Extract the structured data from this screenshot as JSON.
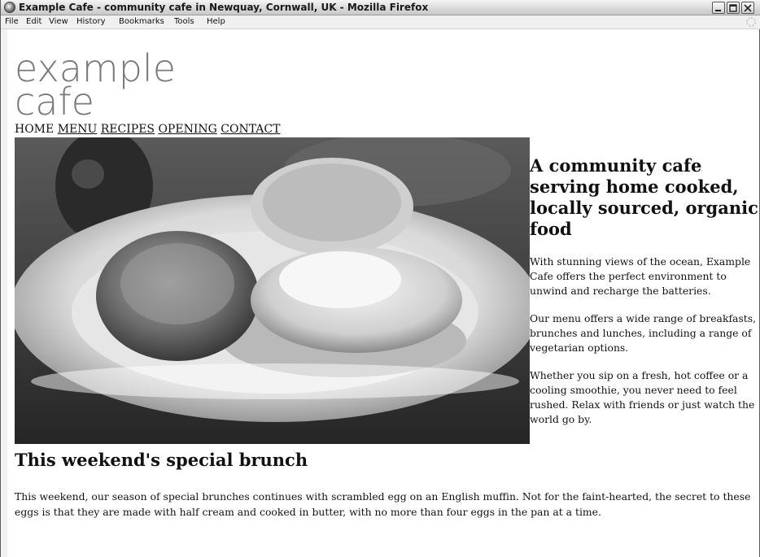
{
  "window": {
    "title": "Example Cafe - community cafe in Newquay, Cornwall, UK - Mozilla Firefox",
    "menu": [
      "File",
      "Edit",
      "View",
      "History",
      "Bookmarks",
      "Tools",
      "Help"
    ]
  },
  "site": {
    "logo_line1": "example",
    "logo_line2": "cafe",
    "nav": [
      "HOME",
      "MENU",
      "RECIPES",
      "OPENING",
      "CONTACT"
    ],
    "sidebar": {
      "heading": "A community cafe serving home cooked, locally sourced, organic food",
      "paragraphs": [
        "With stunning views of the ocean, Example Cafe offers the perfect environment to unwind and recharge the batteries.",
        "Our menu offers a wide range of breakfasts, brunches and lunches, including a range of vegetarian options.",
        "Whether you sip on a fresh, hot coffee or a cooling smoothie, you never need to feel rushed. Relax with friends or just watch the world go by."
      ]
    },
    "special": {
      "heading": "This weekend's special brunch",
      "body": "This weekend, our season of special brunches continues with scrambled egg on an English muffin. Not for the faint-hearted, the secret to these eggs is that they are made with half cream and cooked in butter, with no more than four eggs in the pan at a time."
    }
  },
  "icons": [
    "firefox-icon",
    "minimize-icon",
    "maximize-icon",
    "close-icon",
    "throbber-icon"
  ]
}
